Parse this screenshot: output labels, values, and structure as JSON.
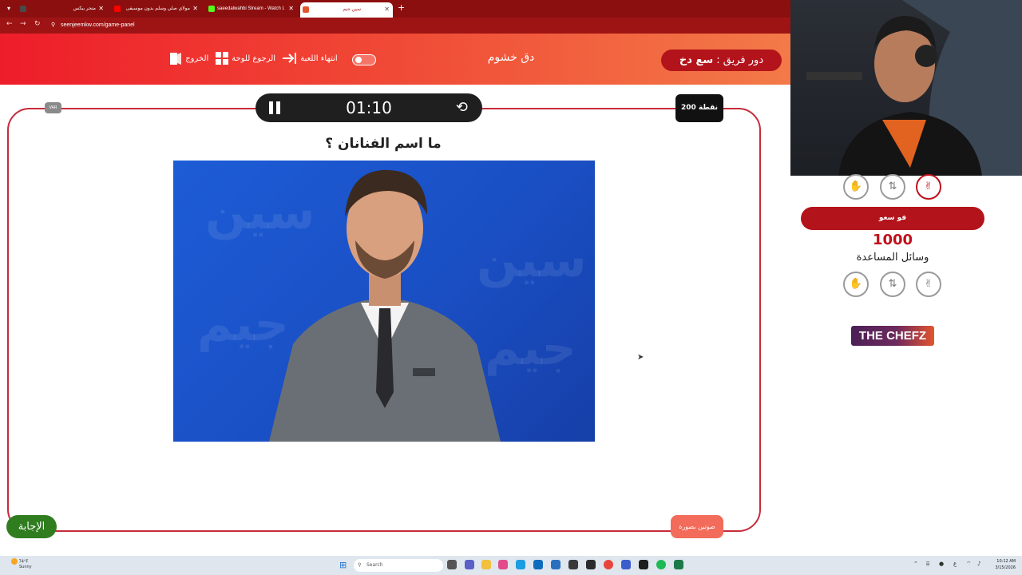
{
  "browser": {
    "tabs": [
      {
        "label": "متجر بيكس",
        "color": "#4a4a4a"
      },
      {
        "label": "مولاي صلي وسلم بدون موسيقى",
        "color": "#ff0000"
      },
      {
        "label": "saeedalwahbi Stream - Watch Liv",
        "color": "#53fc18"
      },
      {
        "label": "سين جيم",
        "color": "#e2542f"
      }
    ],
    "url": "seenjeemkw.com/game-panel"
  },
  "header": {
    "turn_prefix": "دور فريق :",
    "turn_team": "سع دخ",
    "current_team": "دق خشوم",
    "end_game": "انتهاء اللعبة",
    "back_to_board": "الرجوع للوحة",
    "exit": "الخروج"
  },
  "game": {
    "timer": "01:10",
    "points": "200 نقطة",
    "badge": "VAR",
    "question": "ما اسم الفنانان ؟",
    "answer_button": "الإجابة",
    "voice_button": "صوتين بصورة"
  },
  "team_panel": {
    "team_name": "فو سعو",
    "score": "1000",
    "aids_label": "وسائل المساعدة",
    "sponsor": "THE CHEFZ"
  },
  "icons": {
    "lifeline_1": "raised-hand",
    "lifeline_2": "swap-arrows",
    "lifeline_3": "victory-hand"
  },
  "taskbar": {
    "weather_temp": "74°F",
    "weather_desc": "Sunny",
    "search": "Search",
    "time": "10:12 AM",
    "date": "3/15/2026"
  },
  "colors": {
    "accent_red": "#ee1d2a",
    "dark_red": "#b3131b",
    "answer_green": "#2f7d1f"
  }
}
